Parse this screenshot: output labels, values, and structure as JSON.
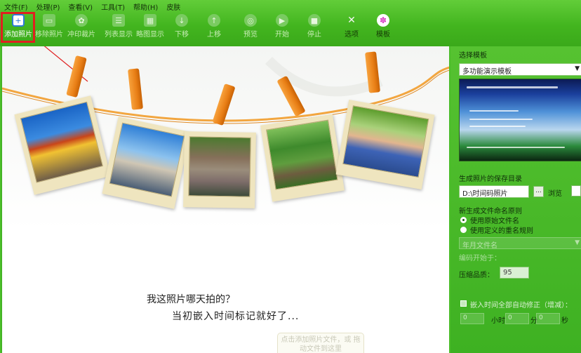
{
  "menu": [
    "文件(F)",
    "处理(P)",
    "查看(V)",
    "工具(T)",
    "帮助(H)",
    "皮肤"
  ],
  "toolbar": {
    "buttons": [
      {
        "label": "添加照片",
        "icon": "add-photo-icon",
        "state": "active"
      },
      {
        "label": "移除照片",
        "icon": "remove-photo-icon",
        "state": "disabled"
      },
      {
        "label": "冲印裁片",
        "icon": "print-crop-icon",
        "state": "disabled"
      },
      {
        "label": "列表显示",
        "icon": "list-view-icon",
        "state": "disabled"
      },
      {
        "label": "略图显示",
        "icon": "thumbnail-view-icon",
        "state": "disabled"
      },
      {
        "label": "下移",
        "icon": "move-down-icon",
        "state": "disabled"
      },
      {
        "label": "上移",
        "icon": "move-up-icon",
        "state": "disabled"
      },
      {
        "label": "预览",
        "icon": "preview-icon",
        "state": "disabled"
      },
      {
        "label": "开始",
        "icon": "start-icon",
        "state": "disabled"
      },
      {
        "label": "停止",
        "icon": "stop-icon",
        "state": "disabled"
      },
      {
        "label": "选项",
        "icon": "tools-icon",
        "state": "enabled"
      },
      {
        "label": "模板",
        "icon": "template-icon",
        "state": "enabled"
      }
    ]
  },
  "preview": {
    "caption_line1": "我这照片哪天拍的？",
    "caption_line2": "当初嵌入时间标记就好了...",
    "hint": "点击添加照片文件，或 拖动文件到这里"
  },
  "panel": {
    "template_section_label": "选择模板",
    "template_selected": "多功能演示模板",
    "output_dir_label": "生成照片的保存目录",
    "output_dir_value": "D:\\时间码照片",
    "dots_label": "...",
    "browse_label": "浏览",
    "naming_label": "新生成文件命名原则",
    "naming_option1": "使用原始文件名",
    "naming_option2": "使用定义的重名规则",
    "rename_select": "年月文件名",
    "start_number_label": "编码开始于：",
    "quality_label": "压缩品质：",
    "quality_value": "95",
    "time_correction_label": "嵌入时间全部自动修正（增减）：",
    "hours_value": "0",
    "hours_unit": "小时",
    "minutes_value": "0",
    "minutes_unit": "分",
    "seconds_value": "0",
    "seconds_unit": "秒"
  },
  "colors": {
    "chrome_green": "#43b51f",
    "highlight_red": "#e02020",
    "clip_orange": "#e97f16",
    "photo_frame": "#efe5bf"
  }
}
